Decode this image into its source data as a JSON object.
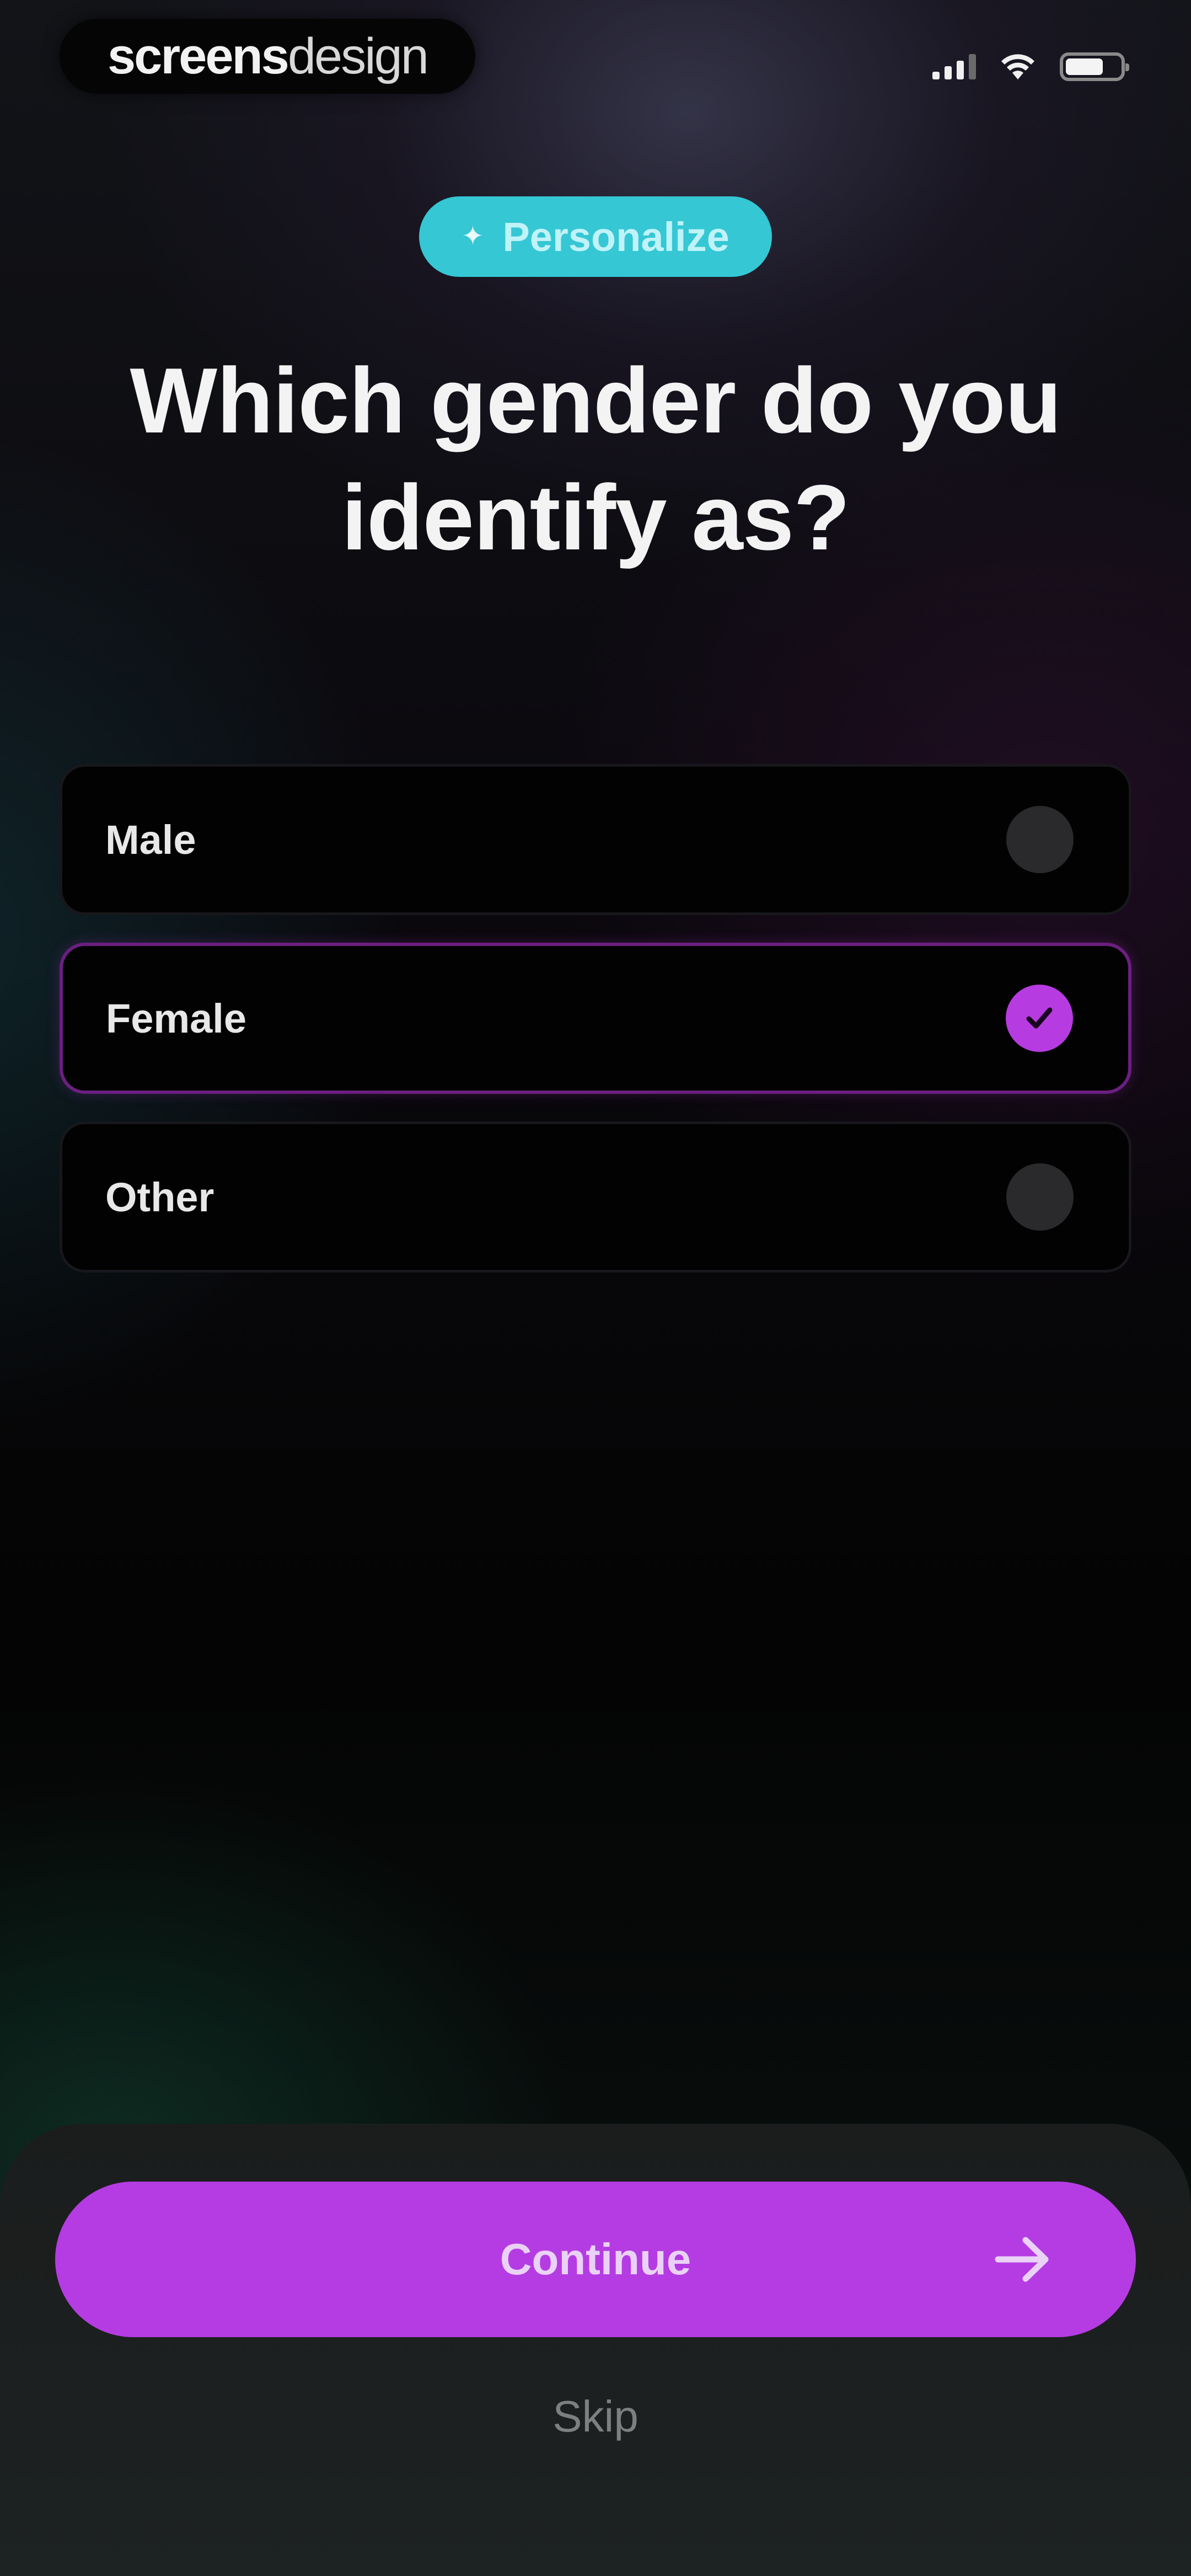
{
  "status_bar": {
    "brand_bold": "screens",
    "brand_light": "design",
    "icons": [
      "cellular-signal-icon",
      "wifi-icon",
      "battery-icon"
    ]
  },
  "tag": {
    "icon": "sparkle-icon",
    "label": "Personalize",
    "color": "#35c7d4"
  },
  "question": "Which gender do you identify as?",
  "options": [
    {
      "label": "Male",
      "selected": false
    },
    {
      "label": "Female",
      "selected": true
    },
    {
      "label": "Other",
      "selected": false
    }
  ],
  "actions": {
    "continue_label": "Continue",
    "continue_icon": "arrow-right-icon",
    "skip_label": "Skip"
  },
  "colors": {
    "accent": "#b53ce3",
    "selected_border": "#6b1f80",
    "tag": "#35c7d4"
  }
}
